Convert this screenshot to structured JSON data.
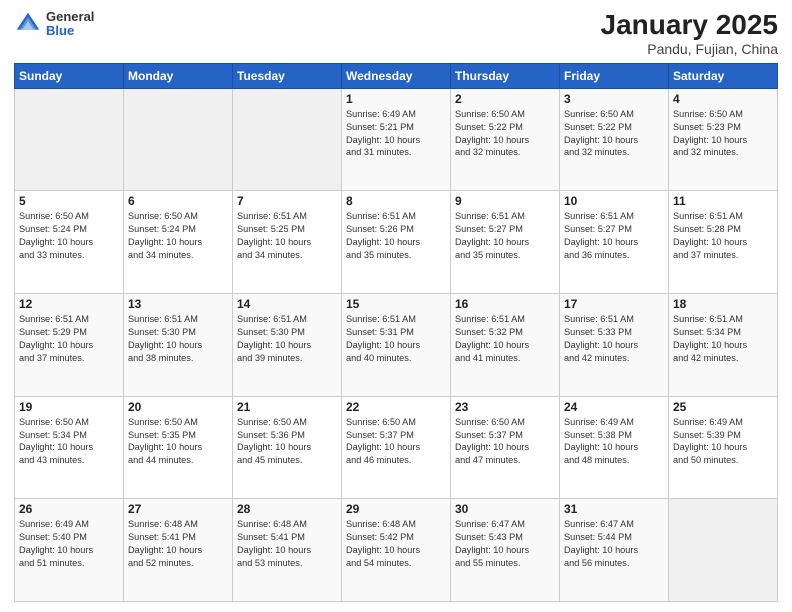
{
  "logo": {
    "general": "General",
    "blue": "Blue"
  },
  "title": "January 2025",
  "subtitle": "Pandu, Fujian, China",
  "days_header": [
    "Sunday",
    "Monday",
    "Tuesday",
    "Wednesday",
    "Thursday",
    "Friday",
    "Saturday"
  ],
  "weeks": [
    [
      {
        "day": "",
        "info": ""
      },
      {
        "day": "",
        "info": ""
      },
      {
        "day": "",
        "info": ""
      },
      {
        "day": "1",
        "info": "Sunrise: 6:49 AM\nSunset: 5:21 PM\nDaylight: 10 hours\nand 31 minutes."
      },
      {
        "day": "2",
        "info": "Sunrise: 6:50 AM\nSunset: 5:22 PM\nDaylight: 10 hours\nand 32 minutes."
      },
      {
        "day": "3",
        "info": "Sunrise: 6:50 AM\nSunset: 5:22 PM\nDaylight: 10 hours\nand 32 minutes."
      },
      {
        "day": "4",
        "info": "Sunrise: 6:50 AM\nSunset: 5:23 PM\nDaylight: 10 hours\nand 32 minutes."
      }
    ],
    [
      {
        "day": "5",
        "info": "Sunrise: 6:50 AM\nSunset: 5:24 PM\nDaylight: 10 hours\nand 33 minutes."
      },
      {
        "day": "6",
        "info": "Sunrise: 6:50 AM\nSunset: 5:24 PM\nDaylight: 10 hours\nand 34 minutes."
      },
      {
        "day": "7",
        "info": "Sunrise: 6:51 AM\nSunset: 5:25 PM\nDaylight: 10 hours\nand 34 minutes."
      },
      {
        "day": "8",
        "info": "Sunrise: 6:51 AM\nSunset: 5:26 PM\nDaylight: 10 hours\nand 35 minutes."
      },
      {
        "day": "9",
        "info": "Sunrise: 6:51 AM\nSunset: 5:27 PM\nDaylight: 10 hours\nand 35 minutes."
      },
      {
        "day": "10",
        "info": "Sunrise: 6:51 AM\nSunset: 5:27 PM\nDaylight: 10 hours\nand 36 minutes."
      },
      {
        "day": "11",
        "info": "Sunrise: 6:51 AM\nSunset: 5:28 PM\nDaylight: 10 hours\nand 37 minutes."
      }
    ],
    [
      {
        "day": "12",
        "info": "Sunrise: 6:51 AM\nSunset: 5:29 PM\nDaylight: 10 hours\nand 37 minutes."
      },
      {
        "day": "13",
        "info": "Sunrise: 6:51 AM\nSunset: 5:30 PM\nDaylight: 10 hours\nand 38 minutes."
      },
      {
        "day": "14",
        "info": "Sunrise: 6:51 AM\nSunset: 5:30 PM\nDaylight: 10 hours\nand 39 minutes."
      },
      {
        "day": "15",
        "info": "Sunrise: 6:51 AM\nSunset: 5:31 PM\nDaylight: 10 hours\nand 40 minutes."
      },
      {
        "day": "16",
        "info": "Sunrise: 6:51 AM\nSunset: 5:32 PM\nDaylight: 10 hours\nand 41 minutes."
      },
      {
        "day": "17",
        "info": "Sunrise: 6:51 AM\nSunset: 5:33 PM\nDaylight: 10 hours\nand 42 minutes."
      },
      {
        "day": "18",
        "info": "Sunrise: 6:51 AM\nSunset: 5:34 PM\nDaylight: 10 hours\nand 42 minutes."
      }
    ],
    [
      {
        "day": "19",
        "info": "Sunrise: 6:50 AM\nSunset: 5:34 PM\nDaylight: 10 hours\nand 43 minutes."
      },
      {
        "day": "20",
        "info": "Sunrise: 6:50 AM\nSunset: 5:35 PM\nDaylight: 10 hours\nand 44 minutes."
      },
      {
        "day": "21",
        "info": "Sunrise: 6:50 AM\nSunset: 5:36 PM\nDaylight: 10 hours\nand 45 minutes."
      },
      {
        "day": "22",
        "info": "Sunrise: 6:50 AM\nSunset: 5:37 PM\nDaylight: 10 hours\nand 46 minutes."
      },
      {
        "day": "23",
        "info": "Sunrise: 6:50 AM\nSunset: 5:37 PM\nDaylight: 10 hours\nand 47 minutes."
      },
      {
        "day": "24",
        "info": "Sunrise: 6:49 AM\nSunset: 5:38 PM\nDaylight: 10 hours\nand 48 minutes."
      },
      {
        "day": "25",
        "info": "Sunrise: 6:49 AM\nSunset: 5:39 PM\nDaylight: 10 hours\nand 50 minutes."
      }
    ],
    [
      {
        "day": "26",
        "info": "Sunrise: 6:49 AM\nSunset: 5:40 PM\nDaylight: 10 hours\nand 51 minutes."
      },
      {
        "day": "27",
        "info": "Sunrise: 6:48 AM\nSunset: 5:41 PM\nDaylight: 10 hours\nand 52 minutes."
      },
      {
        "day": "28",
        "info": "Sunrise: 6:48 AM\nSunset: 5:41 PM\nDaylight: 10 hours\nand 53 minutes."
      },
      {
        "day": "29",
        "info": "Sunrise: 6:48 AM\nSunset: 5:42 PM\nDaylight: 10 hours\nand 54 minutes."
      },
      {
        "day": "30",
        "info": "Sunrise: 6:47 AM\nSunset: 5:43 PM\nDaylight: 10 hours\nand 55 minutes."
      },
      {
        "day": "31",
        "info": "Sunrise: 6:47 AM\nSunset: 5:44 PM\nDaylight: 10 hours\nand 56 minutes."
      },
      {
        "day": "",
        "info": ""
      }
    ]
  ]
}
